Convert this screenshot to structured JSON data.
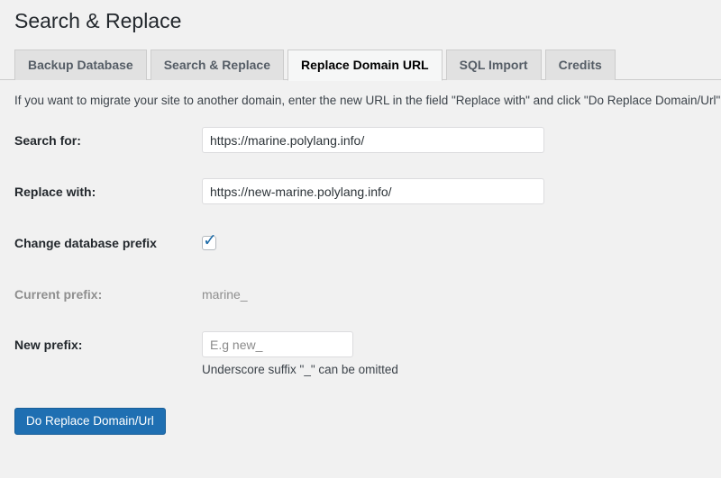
{
  "header": {
    "title": "Search & Replace"
  },
  "tabs": [
    {
      "label": "Backup Database",
      "active": false
    },
    {
      "label": "Search & Replace",
      "active": false
    },
    {
      "label": "Replace Domain URL",
      "active": true
    },
    {
      "label": "SQL Import",
      "active": false
    },
    {
      "label": "Credits",
      "active": false
    }
  ],
  "description": "If you want to migrate your site to another domain, enter the new URL in the field \"Replace with\" and click \"Do Replace Domain/Url\". You",
  "form": {
    "search_for": {
      "label": "Search for:",
      "value": "https://marine.polylang.info/"
    },
    "replace_with": {
      "label": "Replace with:",
      "value": "https://new-marine.polylang.info/"
    },
    "change_prefix": {
      "label": "Change database prefix",
      "checked": true,
      "tick_glyph": "✓"
    },
    "current_prefix": {
      "label": "Current prefix:",
      "value": "marine_"
    },
    "new_prefix": {
      "label": "New prefix:",
      "value": "",
      "placeholder": "E.g new_",
      "hint": "Underscore suffix \"_\" can be omitted"
    }
  },
  "submit": {
    "label": "Do Replace Domain/Url"
  },
  "colors": {
    "page_background": "#f1f1f1",
    "accent_button": "#1f6fb2",
    "checkbox_tick": "#1e6ca8",
    "muted_text": "#8f8f8f",
    "tab_inactive": "#e1e1e1",
    "tab_active": "#f6f7f7"
  }
}
